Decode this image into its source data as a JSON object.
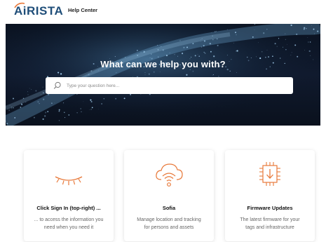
{
  "header": {
    "logo_text": "AiRISTA",
    "help_center_label": "Help Center"
  },
  "hero": {
    "title": "What can we help you with?",
    "search_placeholder": "Type your question here..."
  },
  "cards": [
    {
      "icon": "closed-eye-icon",
      "title": "Click Sign In (top-right) ...",
      "description_line1": "... to access the information you",
      "description_line2": "need when you need it"
    },
    {
      "icon": "cloud-wifi-icon",
      "title": "Sofia",
      "description_line1": "Manage location and tracking",
      "description_line2": "for persons and assets"
    },
    {
      "icon": "chip-download-icon",
      "title": "Firmware Updates",
      "description_line1": "The latest firmware for your",
      "description_line2": "tags and infrastructure"
    }
  ],
  "colors": {
    "accent": "#e8793a",
    "brand": "#1f4e79",
    "hero_bg": "#0c1526"
  }
}
